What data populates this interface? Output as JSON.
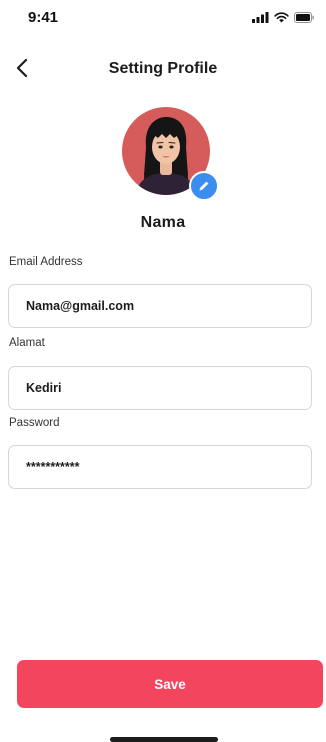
{
  "status_bar": {
    "time": "9:41"
  },
  "header": {
    "title": "Setting Profile"
  },
  "profile": {
    "name": "Nama"
  },
  "form": {
    "email": {
      "label": "Email Address",
      "value": "Nama@gmail.com"
    },
    "address": {
      "label": "Alamat",
      "value": "Kediri"
    },
    "password": {
      "label": "Password",
      "value": "***********"
    }
  },
  "actions": {
    "save_label": "Save"
  },
  "icons": {
    "back": "chevron-left-icon",
    "edit": "pencil-icon",
    "signal": "cellular-signal-icon",
    "wifi": "wifi-icon",
    "battery": "battery-icon"
  },
  "colors": {
    "accent": "#f4455f",
    "edit_badge": "#3b8df0",
    "avatar_bg": "#d65b5b"
  }
}
